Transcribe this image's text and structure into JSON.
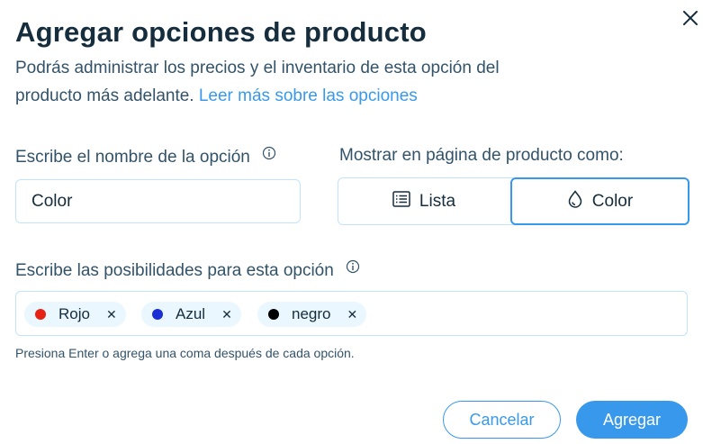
{
  "dialog": {
    "title": "Agregar opciones de producto",
    "description_line1": "Podrás administrar los precios y el inventario de esta opción del",
    "description_line2": "producto más adelante.",
    "learn_more_link": "Leer más sobre las opciones",
    "close_icon": "close-icon"
  },
  "option_name": {
    "label": "Escribe el nombre de la opción",
    "value": "Color",
    "info_icon": "info-icon"
  },
  "display_as": {
    "label": "Mostrar en página de producto como:",
    "options": [
      {
        "label": "Lista",
        "icon": "list-icon",
        "selected": false
      },
      {
        "label": "Color",
        "icon": "color-drop-icon",
        "selected": true
      }
    ]
  },
  "possibilities": {
    "label": "Escribe las posibilidades para esta opción",
    "info_icon": "info-icon",
    "tags": [
      {
        "label": "Rojo",
        "color": "#e62214"
      },
      {
        "label": "Azul",
        "color": "#1a2ed6"
      },
      {
        "label": "negro",
        "color": "#000000"
      }
    ],
    "hint": "Presiona Enter o agrega una coma después de cada opción."
  },
  "footer": {
    "cancel_label": "Cancelar",
    "submit_label": "Agregar"
  },
  "colors": {
    "accent": "#3899ec",
    "text": "#162d3d",
    "secondary_text": "#32536a",
    "border": "#c1e4fe",
    "tag_bg": "#eaf7ff"
  }
}
